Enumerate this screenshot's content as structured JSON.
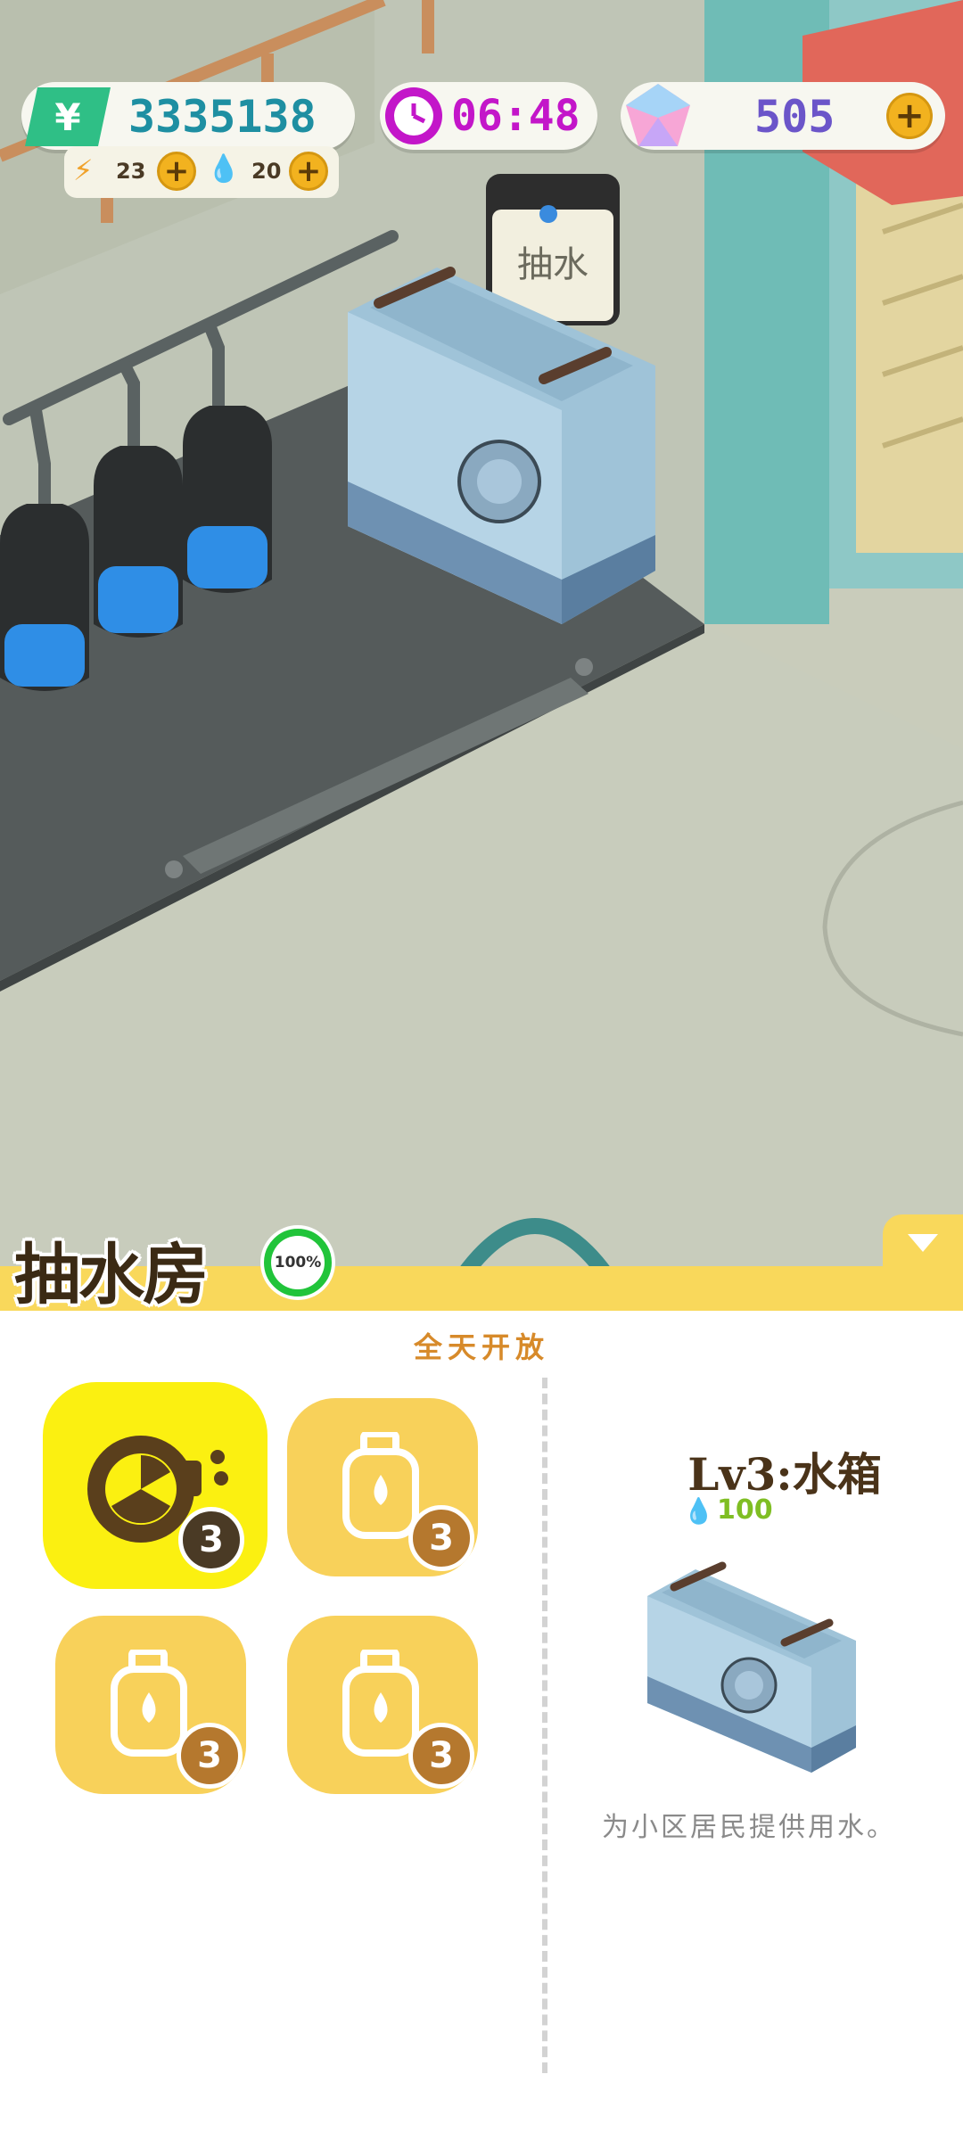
{
  "hud": {
    "money": "3335138",
    "energy": "23",
    "water": "20",
    "clock": "06:48",
    "gems": "505"
  },
  "scene": {
    "machine_sign": "抽水"
  },
  "panel": {
    "title": "抽水房",
    "progress_label": "100%",
    "progress_percent": 100,
    "hours": "全天开放",
    "slots": [
      {
        "icon": "pump-fan-icon",
        "count": "3",
        "selected": true
      },
      {
        "icon": "water-bottle-icon",
        "count": "3",
        "selected": false
      },
      {
        "icon": "water-bottle-icon",
        "count": "3",
        "selected": false
      },
      {
        "icon": "water-bottle-icon",
        "count": "3",
        "selected": false
      }
    ],
    "detail": {
      "level_name": "Lv3:水箱",
      "cost": "100",
      "description": "为小区居民提供用水。"
    }
  },
  "colors": {
    "accent_yellow": "#f9d85b",
    "selected_slot": "#fbf011",
    "money_green": "#2fbf86",
    "clock_purple": "#c316c9",
    "gem_text": "#6b55c9"
  }
}
